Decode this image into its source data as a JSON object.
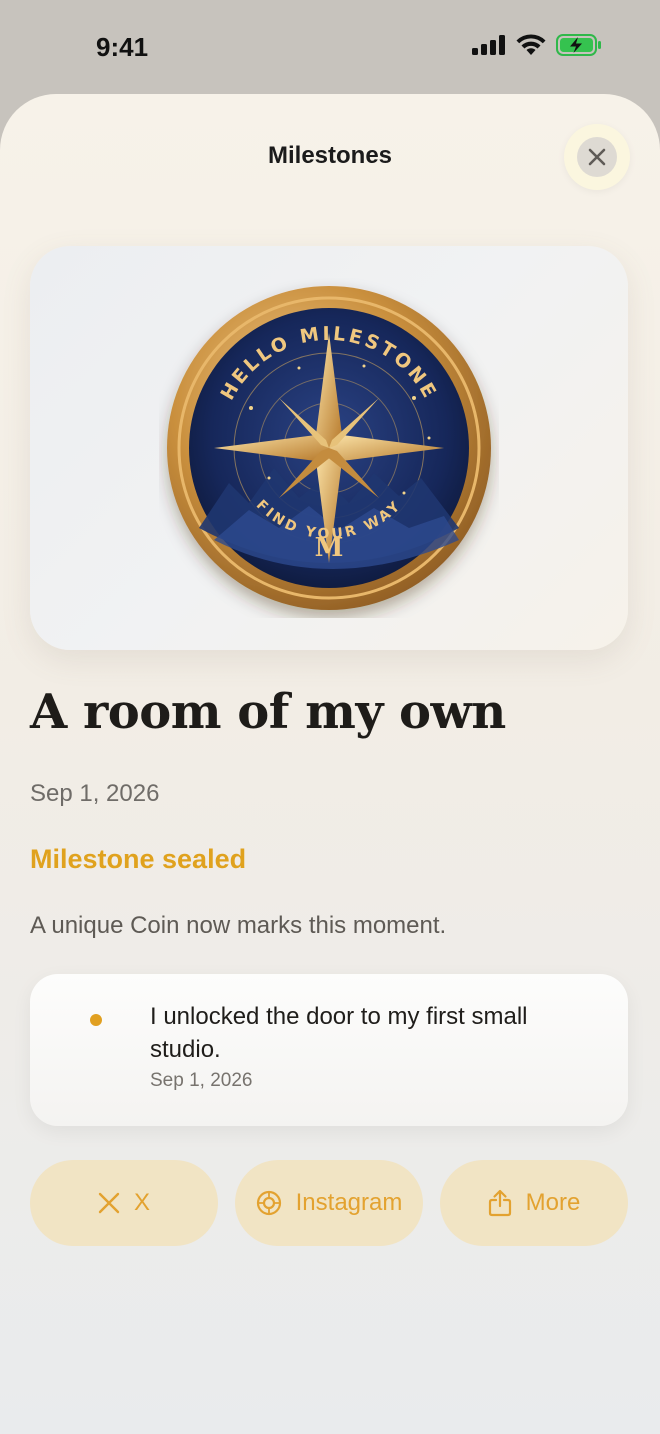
{
  "status_bar": {
    "time": "9:41"
  },
  "sheet": {
    "title": "Milestones"
  },
  "coin": {
    "top_text": "HELLO MILESTONE",
    "bottom_text": "FIND YOUR WAY",
    "monogram": "M"
  },
  "milestone": {
    "title": "A room of my own",
    "date": "Sep 1, 2026",
    "status": "Milestone sealed",
    "description": "A unique Coin now marks this moment."
  },
  "entry": {
    "text": "I unlocked the door to my first small studio.",
    "date": "Sep 1, 2026"
  },
  "share": {
    "x_label": "X",
    "instagram_label": "Instagram",
    "more_label": "More"
  },
  "colors": {
    "accent": "#e0a21e",
    "button_bg": "#f1e4c4",
    "coin_navy": "#14234f",
    "coin_gold": "#c98f3d"
  }
}
